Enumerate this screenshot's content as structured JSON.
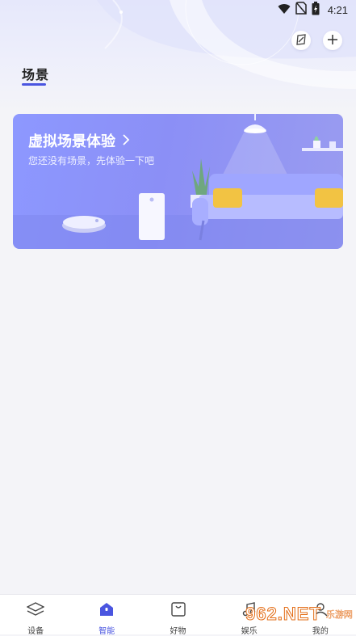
{
  "status_bar": {
    "time": "4:21"
  },
  "header": {
    "title": "场景"
  },
  "card": {
    "title": "虚拟场景体验",
    "subtitle": "您还没有场景，先体验一下吧"
  },
  "tabs": [
    {
      "label": "设备",
      "icon": "layers-icon",
      "active": false
    },
    {
      "label": "智能",
      "icon": "home-icon",
      "active": true
    },
    {
      "label": "好物",
      "icon": "bag-icon",
      "active": false
    },
    {
      "label": "娱乐",
      "icon": "music-icon",
      "active": false
    },
    {
      "label": "我的",
      "icon": "user-icon",
      "active": false
    }
  ],
  "watermark": {
    "brand": "962.NET",
    "sub": "乐游网"
  },
  "colors": {
    "accent": "#4a55e0",
    "card": "#8d98ff",
    "background": "#f4f4f8"
  }
}
